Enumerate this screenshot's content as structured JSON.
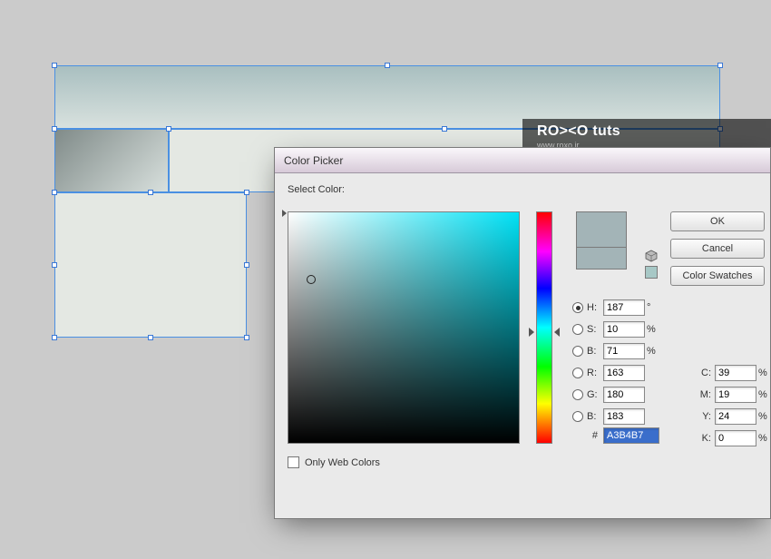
{
  "watermark": {
    "brand_b": "RO",
    "brand_sym": "><",
    "brand_e": "O",
    "suffix": " tuts",
    "url": "www.roxo.ir"
  },
  "dialog": {
    "title": "Color Picker",
    "prompt": "Select Color:",
    "buttons": {
      "ok": "OK",
      "cancel": "Cancel",
      "swatches": "Color Swatches"
    },
    "hsb": {
      "h_label": "H:",
      "h": "187",
      "h_unit": "°",
      "s_label": "S:",
      "s": "10",
      "s_unit": "%",
      "b_label": "B:",
      "b": "71",
      "b_unit": "%"
    },
    "rgb": {
      "r_label": "R:",
      "r": "163",
      "g_label": "G:",
      "g": "180",
      "b_label": "B:",
      "b": "183"
    },
    "cmyk": {
      "c_label": "C:",
      "c": "39",
      "unit": "%",
      "m_label": "M:",
      "m": "19",
      "y_label": "Y:",
      "y": "24",
      "k_label": "K:",
      "k": "0"
    },
    "hex_label": "#",
    "hex": "A3B4B7",
    "only_web": "Only Web Colors"
  },
  "colors": {
    "swatch": "#A3B4B7"
  }
}
